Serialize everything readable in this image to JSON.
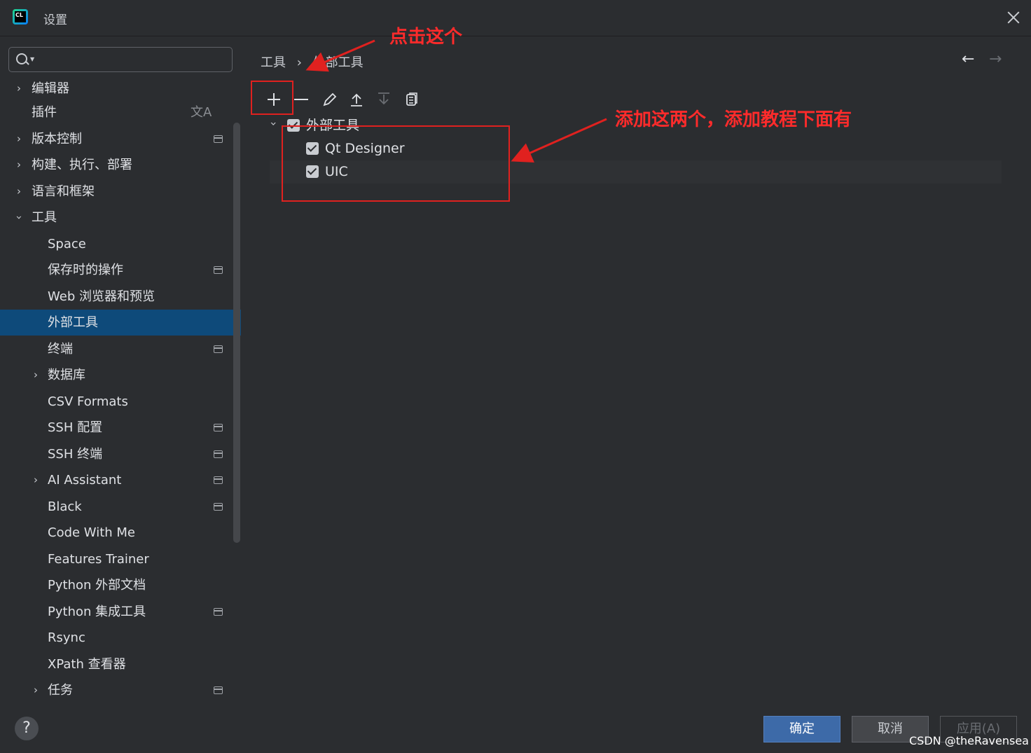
{
  "window": {
    "title": "设置",
    "logo_text": "CL"
  },
  "search": {
    "placeholder": "",
    "value": ""
  },
  "sidebar": {
    "items": [
      {
        "label": "编辑器"
      },
      {
        "label": "插件"
      },
      {
        "label": "版本控制"
      },
      {
        "label": "构建、执行、部署"
      },
      {
        "label": "语言和框架"
      },
      {
        "label": "工具"
      },
      {
        "label": "Space"
      },
      {
        "label": "保存时的操作"
      },
      {
        "label": "Web 浏览器和预览"
      },
      {
        "label": "外部工具"
      },
      {
        "label": "终端"
      },
      {
        "label": "数据库"
      },
      {
        "label": "CSV Formats"
      },
      {
        "label": "SSH 配置"
      },
      {
        "label": "SSH 终端"
      },
      {
        "label": "AI Assistant"
      },
      {
        "label": "Black"
      },
      {
        "label": "Code With Me"
      },
      {
        "label": "Features Trainer"
      },
      {
        "label": "Python 外部文档"
      },
      {
        "label": "Python 集成工具"
      },
      {
        "label": "Rsync"
      },
      {
        "label": "XPath 查看器"
      },
      {
        "label": "任务"
      }
    ],
    "selected": "外部工具",
    "translate_glyph": "文A"
  },
  "breadcrumb": {
    "parent": "工具",
    "separator": "›",
    "current": "外部工具"
  },
  "nav": {
    "back": "←",
    "forward": "→"
  },
  "toolbar": {
    "icons": [
      "add-icon",
      "remove-icon",
      "edit-icon",
      "move-up-icon",
      "move-down-icon",
      "copy-icon"
    ]
  },
  "tree": {
    "group": {
      "label": "外部工具",
      "checked": true,
      "expanded": true
    },
    "children": [
      {
        "label": "Qt Designer",
        "checked": true
      },
      {
        "label": "UIC",
        "checked": true
      }
    ]
  },
  "annotations": {
    "click_this": "点击这个",
    "add_these_two": "添加这两个，添加教程下面有",
    "color": "#e0211f"
  },
  "footer": {
    "ok": "确定",
    "cancel": "取消",
    "apply": "应用(A)",
    "help": "?"
  },
  "watermark": "CSDN @theRavensea",
  "colors": {
    "background": "#2b2d30",
    "selection": "#0e4a7a",
    "primary_button": "#3d6aa8"
  }
}
